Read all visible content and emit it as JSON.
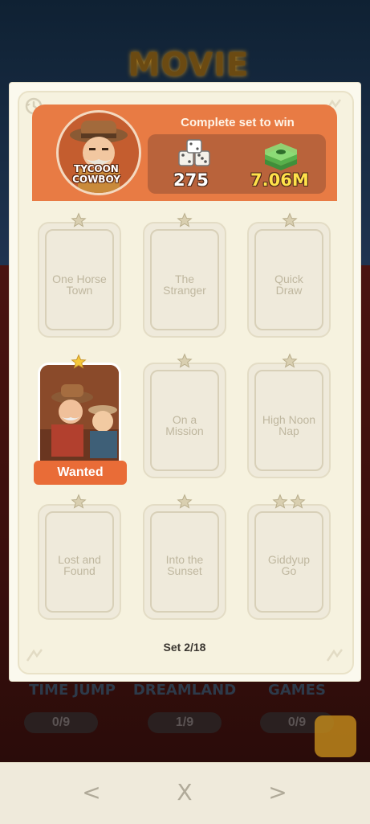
{
  "background": {
    "event_title": "MOVIE",
    "sets": [
      {
        "name": "TIME JUMP",
        "progress": "0/9"
      },
      {
        "name": "DREAMLAND",
        "progress": "1/9"
      },
      {
        "name": "GAMES",
        "progress": "0/9"
      }
    ]
  },
  "header": {
    "set_name": "TYCOON\nCOWBOY",
    "complete_text": "Complete set to win",
    "rewards": {
      "dice": "275",
      "cash": "7.06M"
    },
    "colors": {
      "accent": "#e87b44",
      "reward_box": "#b9633b",
      "cash": "#ffe14a"
    }
  },
  "cards": [
    {
      "label": "One Horse\nTown",
      "stars": 1,
      "owned": false
    },
    {
      "label": "The\nStranger",
      "stars": 1,
      "owned": false
    },
    {
      "label": "Quick\nDraw",
      "stars": 1,
      "owned": false
    },
    {
      "label": "Wanted",
      "stars": 1,
      "owned": true
    },
    {
      "label": "On a\nMission",
      "stars": 1,
      "owned": false
    },
    {
      "label": "High Noon\nNap",
      "stars": 1,
      "owned": false
    },
    {
      "label": "Lost and\nFound",
      "stars": 1,
      "owned": false
    },
    {
      "label": "Into the\nSunset",
      "stars": 1,
      "owned": false
    },
    {
      "label": "Giddyup\nGo",
      "stars": 2,
      "owned": false
    }
  ],
  "footer": {
    "set_indicator": "Set 2/18"
  },
  "nav": {
    "prev": "<",
    "close": "X",
    "next": ">"
  }
}
